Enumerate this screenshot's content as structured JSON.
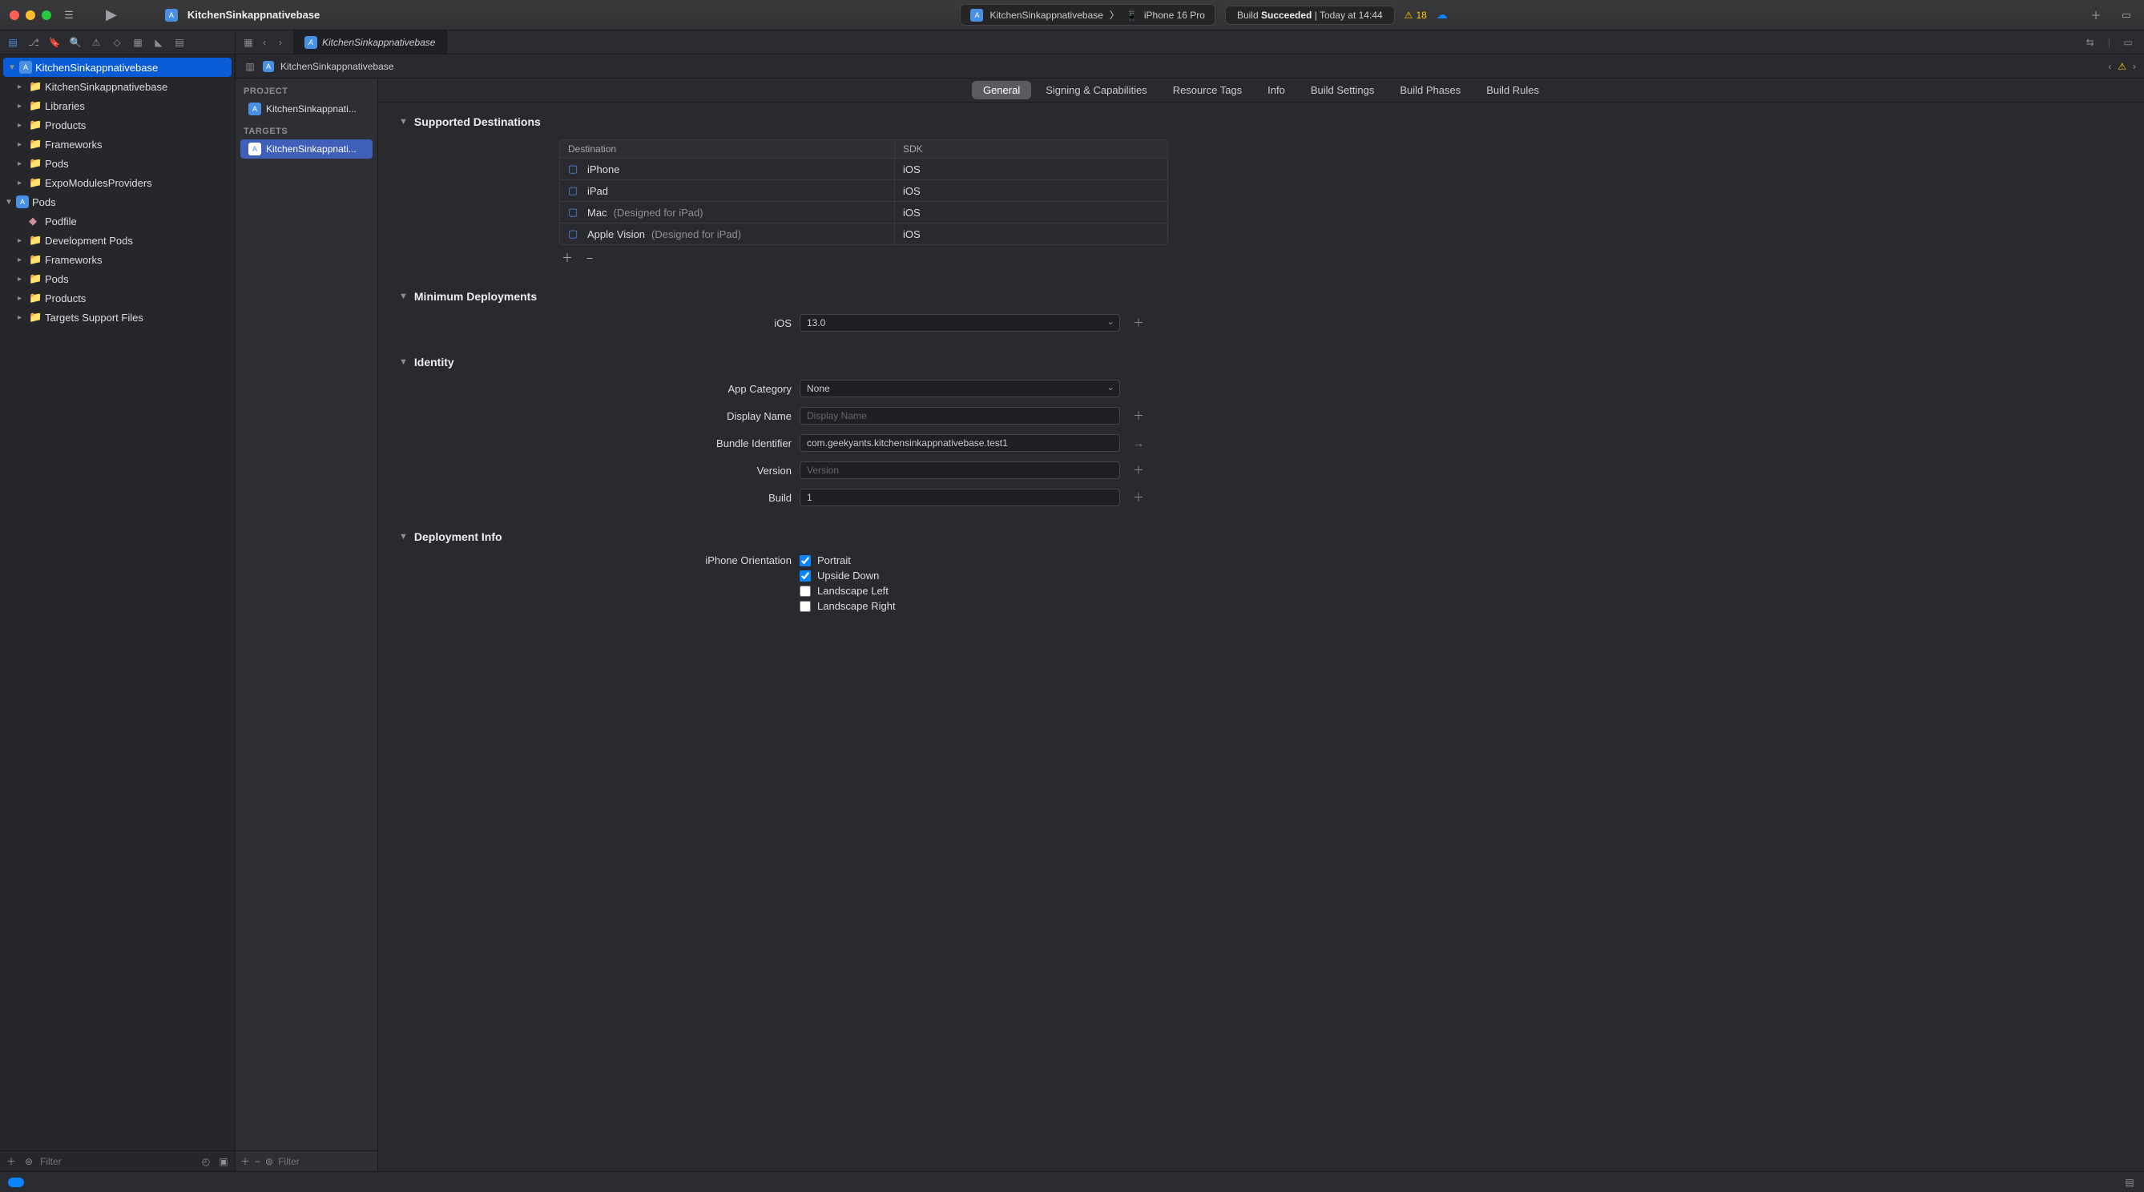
{
  "titlebar": {
    "project_name": "KitchenSinkappnativebase",
    "scheme": "KitchenSinkappnativebase",
    "device": "iPhone 16 Pro",
    "status_build": "Build",
    "status_result": "Succeeded",
    "status_sep": " | ",
    "status_time": "Today at 14:44",
    "warning_count": "18"
  },
  "tabstrip": {
    "active_tab": "KitchenSinkappnativebase"
  },
  "navigator": {
    "items": [
      {
        "label": "KitchenSinkappnativebase",
        "type": "project",
        "depth": 0,
        "open": true,
        "selected": true
      },
      {
        "label": "KitchenSinkappnativebase",
        "type": "folder",
        "depth": 1
      },
      {
        "label": "Libraries",
        "type": "folder",
        "depth": 1
      },
      {
        "label": "Products",
        "type": "folder",
        "depth": 1
      },
      {
        "label": "Frameworks",
        "type": "folder",
        "depth": 1
      },
      {
        "label": "Pods",
        "type": "folder",
        "depth": 1
      },
      {
        "label": "ExpoModulesProviders",
        "type": "folder",
        "depth": 1
      },
      {
        "label": "Pods",
        "type": "project",
        "depth": 0,
        "open": true
      },
      {
        "label": "Podfile",
        "type": "file",
        "depth": 1
      },
      {
        "label": "Development Pods",
        "type": "folder",
        "depth": 1
      },
      {
        "label": "Frameworks",
        "type": "folder",
        "depth": 1
      },
      {
        "label": "Pods",
        "type": "folder",
        "depth": 1
      },
      {
        "label": "Products",
        "type": "folder",
        "depth": 1
      },
      {
        "label": "Targets Support Files",
        "type": "folder",
        "depth": 1
      }
    ],
    "filter_placeholder": "Filter"
  },
  "crumb": {
    "project": "KitchenSinkappnativebase"
  },
  "targets_panel": {
    "project_header": "PROJECT",
    "project_item": "KitchenSinkappnati...",
    "targets_header": "TARGETS",
    "target_item": "KitchenSinkappnati...",
    "filter_placeholder": "Filter"
  },
  "seg_tabs": [
    "General",
    "Signing & Capabilities",
    "Resource Tags",
    "Info",
    "Build Settings",
    "Build Phases",
    "Build Rules"
  ],
  "sections": {
    "supported_destinations": {
      "title": "Supported Destinations",
      "head_destination": "Destination",
      "head_sdk": "SDK",
      "rows": [
        {
          "name": "iPhone",
          "suffix": "",
          "sdk": "iOS"
        },
        {
          "name": "iPad",
          "suffix": "",
          "sdk": "iOS"
        },
        {
          "name": "Mac",
          "suffix": " (Designed for iPad)",
          "sdk": "iOS"
        },
        {
          "name": "Apple Vision",
          "suffix": " (Designed for iPad)",
          "sdk": "iOS"
        }
      ]
    },
    "minimum_deployments": {
      "title": "Minimum Deployments",
      "label": "iOS",
      "value": "13.0"
    },
    "identity": {
      "title": "Identity",
      "app_category_label": "App Category",
      "app_category_value": "None",
      "display_name_label": "Display Name",
      "display_name_placeholder": "Display Name",
      "bundle_id_label": "Bundle Identifier",
      "bundle_id_value": "com.geekyants.kitchensinkappnativebase.test1",
      "version_label": "Version",
      "version_placeholder": "Version",
      "build_label": "Build",
      "build_value": "1"
    },
    "deployment_info": {
      "title": "Deployment Info",
      "orientation_label": "iPhone Orientation",
      "options": [
        {
          "label": "Portrait",
          "checked": true
        },
        {
          "label": "Upside Down",
          "checked": true
        },
        {
          "label": "Landscape Left",
          "checked": false
        },
        {
          "label": "Landscape Right",
          "checked": false
        }
      ]
    }
  }
}
